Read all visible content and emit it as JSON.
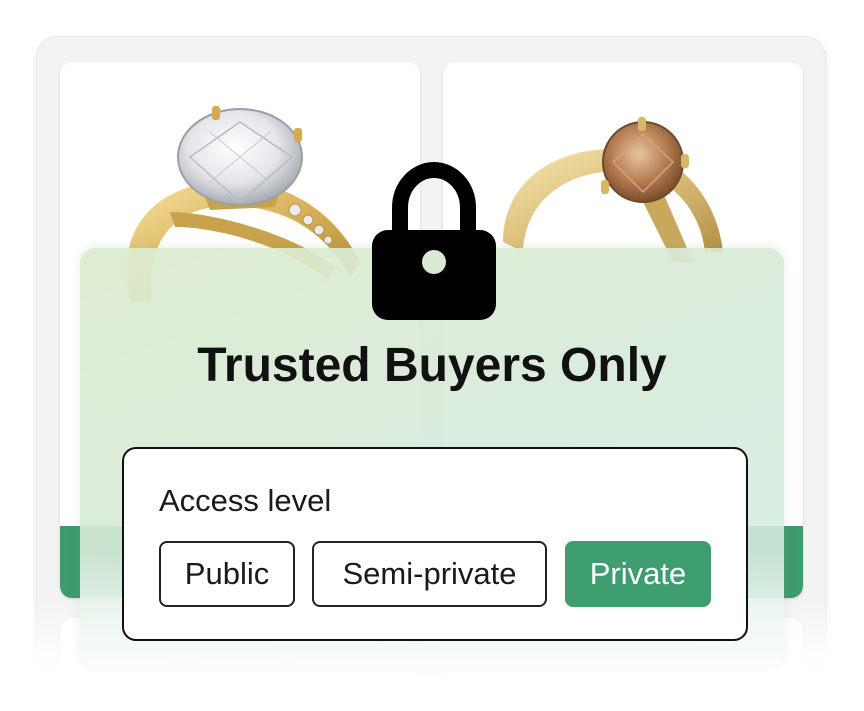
{
  "title": "Trusted Buyers Only",
  "lock_icon": "lock-icon",
  "access": {
    "label": "Access level",
    "options": [
      "Public",
      "Semi-private",
      "Private"
    ],
    "selected": "Private"
  },
  "colors": {
    "accent_green": "#3f9e70",
    "panel_tint": "#d8ebd6",
    "text_dark": "#111111"
  },
  "products": [
    {
      "image": "gold-ring-white-diamond"
    },
    {
      "image": "gold-ring-champagne-diamond"
    }
  ]
}
